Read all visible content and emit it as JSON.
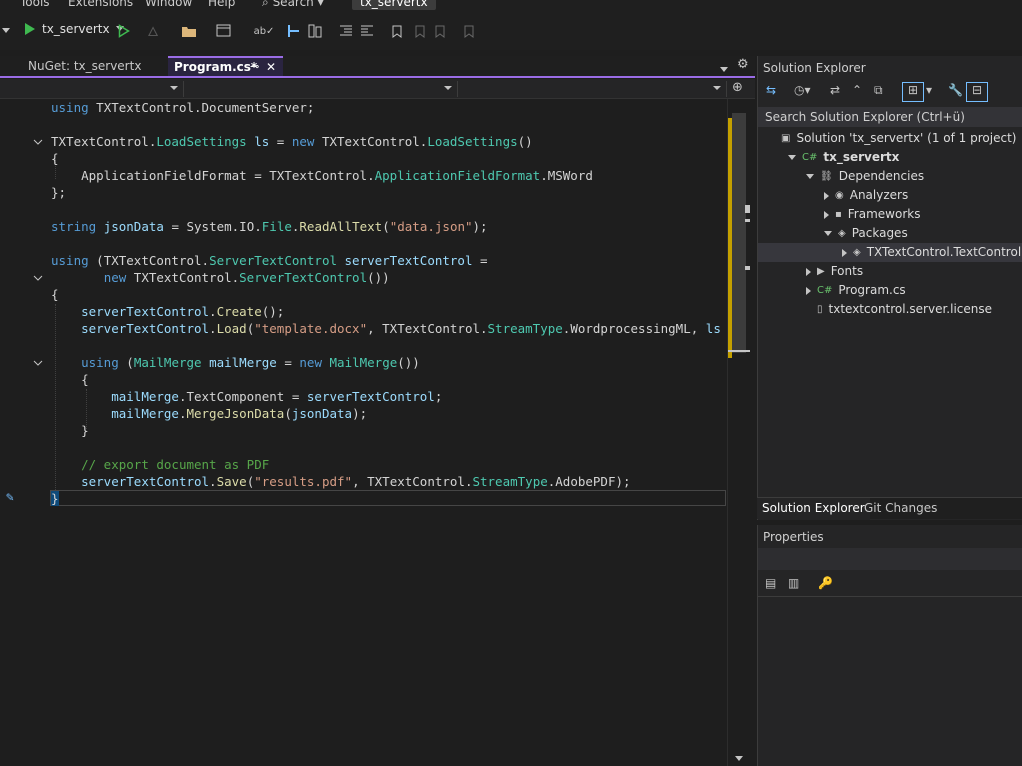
{
  "menu": {
    "items": [
      "Tools",
      "Extensions",
      "Window",
      "Help"
    ],
    "search_label": "Search",
    "project_badge": "tx_servertx"
  },
  "toolbar": {
    "project": "tx_servertx"
  },
  "tabs": [
    {
      "label": "NuGet: tx_servertx",
      "active": false
    },
    {
      "label": "Program.cs*",
      "active": true
    }
  ],
  "code": [
    "using TXTextControl.DocumentServer;",
    "",
    "TXTextControl.LoadSettings ls = new TXTextControl.LoadSettings()",
    "{",
    "    ApplicationFieldFormat = TXTextControl.ApplicationFieldFormat.MSWord",
    "};",
    "",
    "string jsonData = System.IO.File.ReadAllText(\"data.json\");",
    "",
    "using (TXTextControl.ServerTextControl serverTextControl =",
    "       new TXTextControl.ServerTextControl())",
    "{",
    "    serverTextControl.Create();",
    "    serverTextControl.Load(\"template.docx\", TXTextControl.StreamType.WordprocessingML, ls",
    "",
    "    using (MailMerge mailMerge = new MailMerge())",
    "    {",
    "        mailMerge.TextComponent = serverTextControl;",
    "        mailMerge.MergeJsonData(jsonData);",
    "    }",
    "",
    "    // export document as PDF",
    "    serverTextControl.Save(\"results.pdf\", TXTextControl.StreamType.AdobePDF);",
    "}"
  ],
  "solution_explorer": {
    "title": "Solution Explorer",
    "search_placeholder": "Search Solution Explorer (Ctrl+ü)",
    "tree": [
      {
        "label": "Solution 'tx_servertx' (1 of 1 project)",
        "depth": 0,
        "expand": "none",
        "icon": "solution-icon"
      },
      {
        "label": "tx_servertx",
        "depth": 1,
        "expand": "down",
        "icon": "csharp-project-icon",
        "bold": true
      },
      {
        "label": "Dependencies",
        "depth": 2,
        "expand": "down",
        "icon": "dependencies-icon"
      },
      {
        "label": "Analyzers",
        "depth": 3,
        "expand": "right",
        "icon": "analyzers-icon"
      },
      {
        "label": "Frameworks",
        "depth": 3,
        "expand": "right",
        "icon": "frameworks-icon"
      },
      {
        "label": "Packages",
        "depth": 3,
        "expand": "down",
        "icon": "packages-icon"
      },
      {
        "label": "TXTextControl.TextControl.Co",
        "depth": 4,
        "expand": "right",
        "icon": "package-icon",
        "selected": true
      },
      {
        "label": "Fonts",
        "depth": 2,
        "expand": "right",
        "icon": "folder-icon"
      },
      {
        "label": "Program.cs",
        "depth": 2,
        "expand": "right",
        "icon": "csharp-file-icon"
      },
      {
        "label": "txtextcontrol.server.license",
        "depth": 2,
        "expand": "none",
        "icon": "file-icon"
      }
    ],
    "bottom_tabs": [
      "Solution Explorer",
      "Git Changes"
    ]
  },
  "properties": {
    "title": "Properties"
  }
}
